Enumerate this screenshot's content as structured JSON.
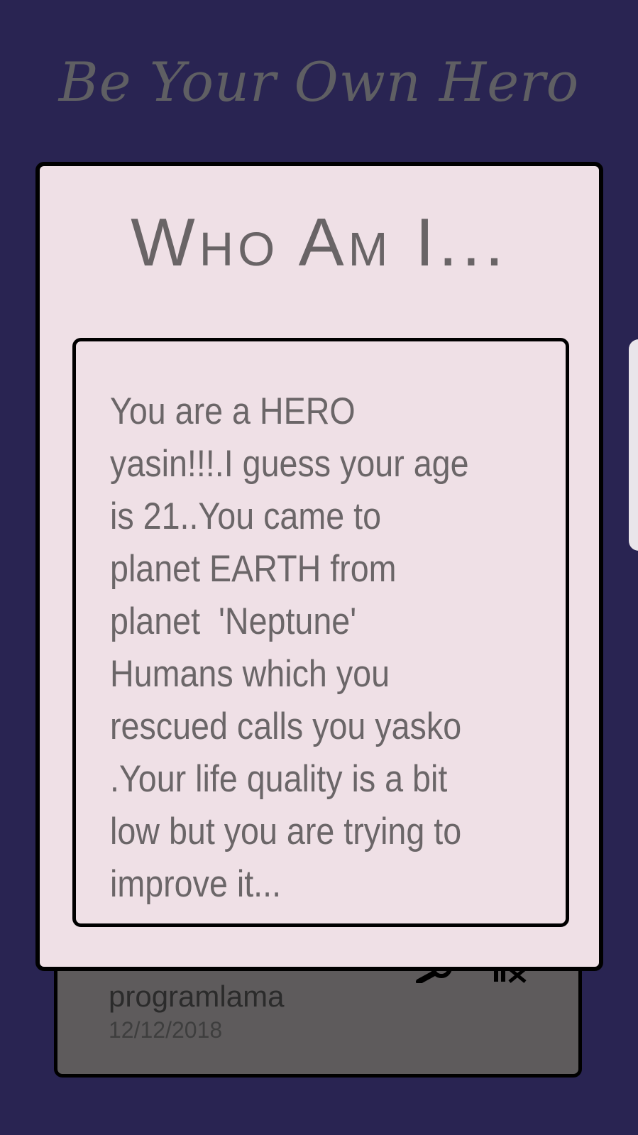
{
  "app": {
    "title": "Be Your Own Hero"
  },
  "list_item": {
    "title": "programlama",
    "date": "12/12/2018",
    "icons": [
      "search-icon",
      "delete-icon"
    ]
  },
  "dialog": {
    "title": "Who Am I...",
    "result_text": "You are a HERO yasin!!!.I guess your age is 21..You came to planet EARTH from planet  'Neptune' Humans which you rescued calls you yasko .Your life quality is a bit low but you are trying to improve it..."
  },
  "colors": {
    "background": "#292452",
    "dialog_background": "#efe0e6",
    "text": "#6b6668",
    "card_background": "#5e5b5c"
  }
}
